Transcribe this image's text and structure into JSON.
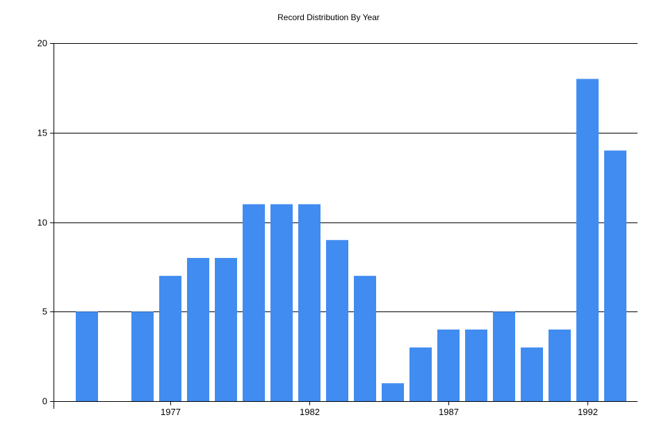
{
  "chart_data": {
    "type": "bar",
    "title": "Record Distribution By Year",
    "xlabel": "",
    "ylabel": "",
    "ylim": [
      0,
      20
    ],
    "yticks": [
      0,
      5,
      10,
      15,
      20
    ],
    "xticks": [
      1977,
      1982,
      1987,
      1992
    ],
    "grid": true,
    "bar_color": "#418CF0",
    "categories": [
      1974,
      1975,
      1976,
      1977,
      1978,
      1979,
      1980,
      1981,
      1982,
      1983,
      1984,
      1985,
      1986,
      1987,
      1988,
      1989,
      1990,
      1991,
      1992,
      1993
    ],
    "values": [
      5,
      0,
      5,
      7,
      8,
      8,
      11,
      11,
      11,
      9,
      7,
      1,
      3,
      4,
      4,
      5,
      3,
      4,
      18,
      14
    ]
  }
}
